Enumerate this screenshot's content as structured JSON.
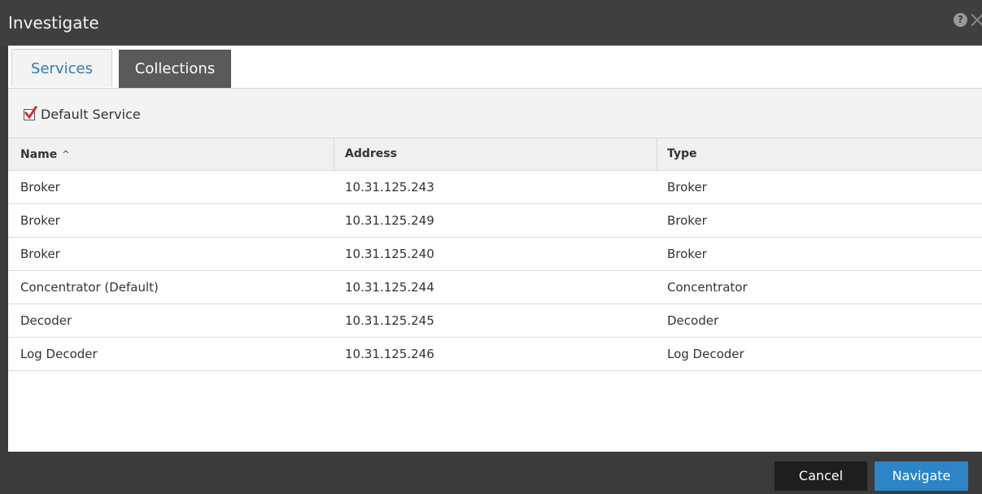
{
  "window": {
    "title": "Investigate",
    "help_icon": "question-circle-icon",
    "close_icon": "close-x-icon"
  },
  "tabs": [
    {
      "label": "Services",
      "active": true
    },
    {
      "label": "Collections",
      "active": false
    }
  ],
  "toolbar": {
    "default_service_label": "Default Service",
    "default_service_checked": true
  },
  "table": {
    "columns": [
      {
        "label": "Name",
        "sort": "ascending"
      },
      {
        "label": "Address"
      },
      {
        "label": "Type"
      }
    ],
    "sort_icon": "chevron-up-icon",
    "rows": [
      {
        "name": "Broker",
        "address": "10.31.125.243",
        "type": "Broker"
      },
      {
        "name": "Broker",
        "address": "10.31.125.249",
        "type": "Broker"
      },
      {
        "name": "Broker",
        "address": "10.31.125.240",
        "type": "Broker"
      },
      {
        "name": "Concentrator (Default)",
        "address": "10.31.125.244",
        "type": "Concentrator"
      },
      {
        "name": "Decoder",
        "address": "10.31.125.245",
        "type": "Decoder"
      },
      {
        "name": "Log Decoder",
        "address": "10.31.125.246",
        "type": "Log Decoder"
      }
    ]
  },
  "footer": {
    "cancel_label": "Cancel",
    "navigate_label": "Navigate"
  },
  "colors": {
    "accent": "#2d84c6",
    "active_tab_text": "#2d7bb8",
    "checkmark": "#d0312d",
    "chrome": "#3b3b3b"
  }
}
